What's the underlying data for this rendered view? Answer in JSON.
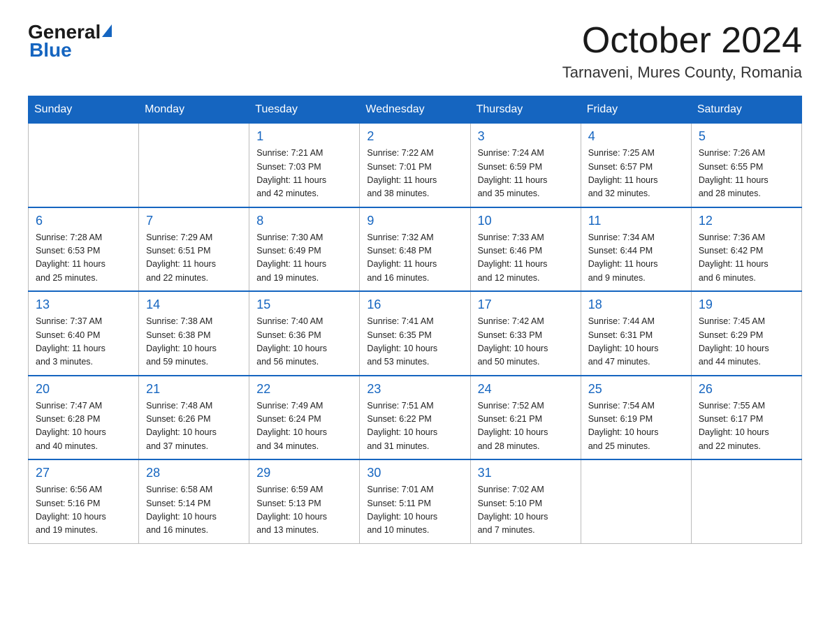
{
  "header": {
    "logo_general": "General",
    "logo_blue": "Blue",
    "month_title": "October 2024",
    "location": "Tarnaveni, Mures County, Romania"
  },
  "weekdays": [
    "Sunday",
    "Monday",
    "Tuesday",
    "Wednesday",
    "Thursday",
    "Friday",
    "Saturday"
  ],
  "weeks": [
    [
      {
        "day": "",
        "info": ""
      },
      {
        "day": "",
        "info": ""
      },
      {
        "day": "1",
        "info": "Sunrise: 7:21 AM\nSunset: 7:03 PM\nDaylight: 11 hours\nand 42 minutes."
      },
      {
        "day": "2",
        "info": "Sunrise: 7:22 AM\nSunset: 7:01 PM\nDaylight: 11 hours\nand 38 minutes."
      },
      {
        "day": "3",
        "info": "Sunrise: 7:24 AM\nSunset: 6:59 PM\nDaylight: 11 hours\nand 35 minutes."
      },
      {
        "day": "4",
        "info": "Sunrise: 7:25 AM\nSunset: 6:57 PM\nDaylight: 11 hours\nand 32 minutes."
      },
      {
        "day": "5",
        "info": "Sunrise: 7:26 AM\nSunset: 6:55 PM\nDaylight: 11 hours\nand 28 minutes."
      }
    ],
    [
      {
        "day": "6",
        "info": "Sunrise: 7:28 AM\nSunset: 6:53 PM\nDaylight: 11 hours\nand 25 minutes."
      },
      {
        "day": "7",
        "info": "Sunrise: 7:29 AM\nSunset: 6:51 PM\nDaylight: 11 hours\nand 22 minutes."
      },
      {
        "day": "8",
        "info": "Sunrise: 7:30 AM\nSunset: 6:49 PM\nDaylight: 11 hours\nand 19 minutes."
      },
      {
        "day": "9",
        "info": "Sunrise: 7:32 AM\nSunset: 6:48 PM\nDaylight: 11 hours\nand 16 minutes."
      },
      {
        "day": "10",
        "info": "Sunrise: 7:33 AM\nSunset: 6:46 PM\nDaylight: 11 hours\nand 12 minutes."
      },
      {
        "day": "11",
        "info": "Sunrise: 7:34 AM\nSunset: 6:44 PM\nDaylight: 11 hours\nand 9 minutes."
      },
      {
        "day": "12",
        "info": "Sunrise: 7:36 AM\nSunset: 6:42 PM\nDaylight: 11 hours\nand 6 minutes."
      }
    ],
    [
      {
        "day": "13",
        "info": "Sunrise: 7:37 AM\nSunset: 6:40 PM\nDaylight: 11 hours\nand 3 minutes."
      },
      {
        "day": "14",
        "info": "Sunrise: 7:38 AM\nSunset: 6:38 PM\nDaylight: 10 hours\nand 59 minutes."
      },
      {
        "day": "15",
        "info": "Sunrise: 7:40 AM\nSunset: 6:36 PM\nDaylight: 10 hours\nand 56 minutes."
      },
      {
        "day": "16",
        "info": "Sunrise: 7:41 AM\nSunset: 6:35 PM\nDaylight: 10 hours\nand 53 minutes."
      },
      {
        "day": "17",
        "info": "Sunrise: 7:42 AM\nSunset: 6:33 PM\nDaylight: 10 hours\nand 50 minutes."
      },
      {
        "day": "18",
        "info": "Sunrise: 7:44 AM\nSunset: 6:31 PM\nDaylight: 10 hours\nand 47 minutes."
      },
      {
        "day": "19",
        "info": "Sunrise: 7:45 AM\nSunset: 6:29 PM\nDaylight: 10 hours\nand 44 minutes."
      }
    ],
    [
      {
        "day": "20",
        "info": "Sunrise: 7:47 AM\nSunset: 6:28 PM\nDaylight: 10 hours\nand 40 minutes."
      },
      {
        "day": "21",
        "info": "Sunrise: 7:48 AM\nSunset: 6:26 PM\nDaylight: 10 hours\nand 37 minutes."
      },
      {
        "day": "22",
        "info": "Sunrise: 7:49 AM\nSunset: 6:24 PM\nDaylight: 10 hours\nand 34 minutes."
      },
      {
        "day": "23",
        "info": "Sunrise: 7:51 AM\nSunset: 6:22 PM\nDaylight: 10 hours\nand 31 minutes."
      },
      {
        "day": "24",
        "info": "Sunrise: 7:52 AM\nSunset: 6:21 PM\nDaylight: 10 hours\nand 28 minutes."
      },
      {
        "day": "25",
        "info": "Sunrise: 7:54 AM\nSunset: 6:19 PM\nDaylight: 10 hours\nand 25 minutes."
      },
      {
        "day": "26",
        "info": "Sunrise: 7:55 AM\nSunset: 6:17 PM\nDaylight: 10 hours\nand 22 minutes."
      }
    ],
    [
      {
        "day": "27",
        "info": "Sunrise: 6:56 AM\nSunset: 5:16 PM\nDaylight: 10 hours\nand 19 minutes."
      },
      {
        "day": "28",
        "info": "Sunrise: 6:58 AM\nSunset: 5:14 PM\nDaylight: 10 hours\nand 16 minutes."
      },
      {
        "day": "29",
        "info": "Sunrise: 6:59 AM\nSunset: 5:13 PM\nDaylight: 10 hours\nand 13 minutes."
      },
      {
        "day": "30",
        "info": "Sunrise: 7:01 AM\nSunset: 5:11 PM\nDaylight: 10 hours\nand 10 minutes."
      },
      {
        "day": "31",
        "info": "Sunrise: 7:02 AM\nSunset: 5:10 PM\nDaylight: 10 hours\nand 7 minutes."
      },
      {
        "day": "",
        "info": ""
      },
      {
        "day": "",
        "info": ""
      }
    ]
  ]
}
